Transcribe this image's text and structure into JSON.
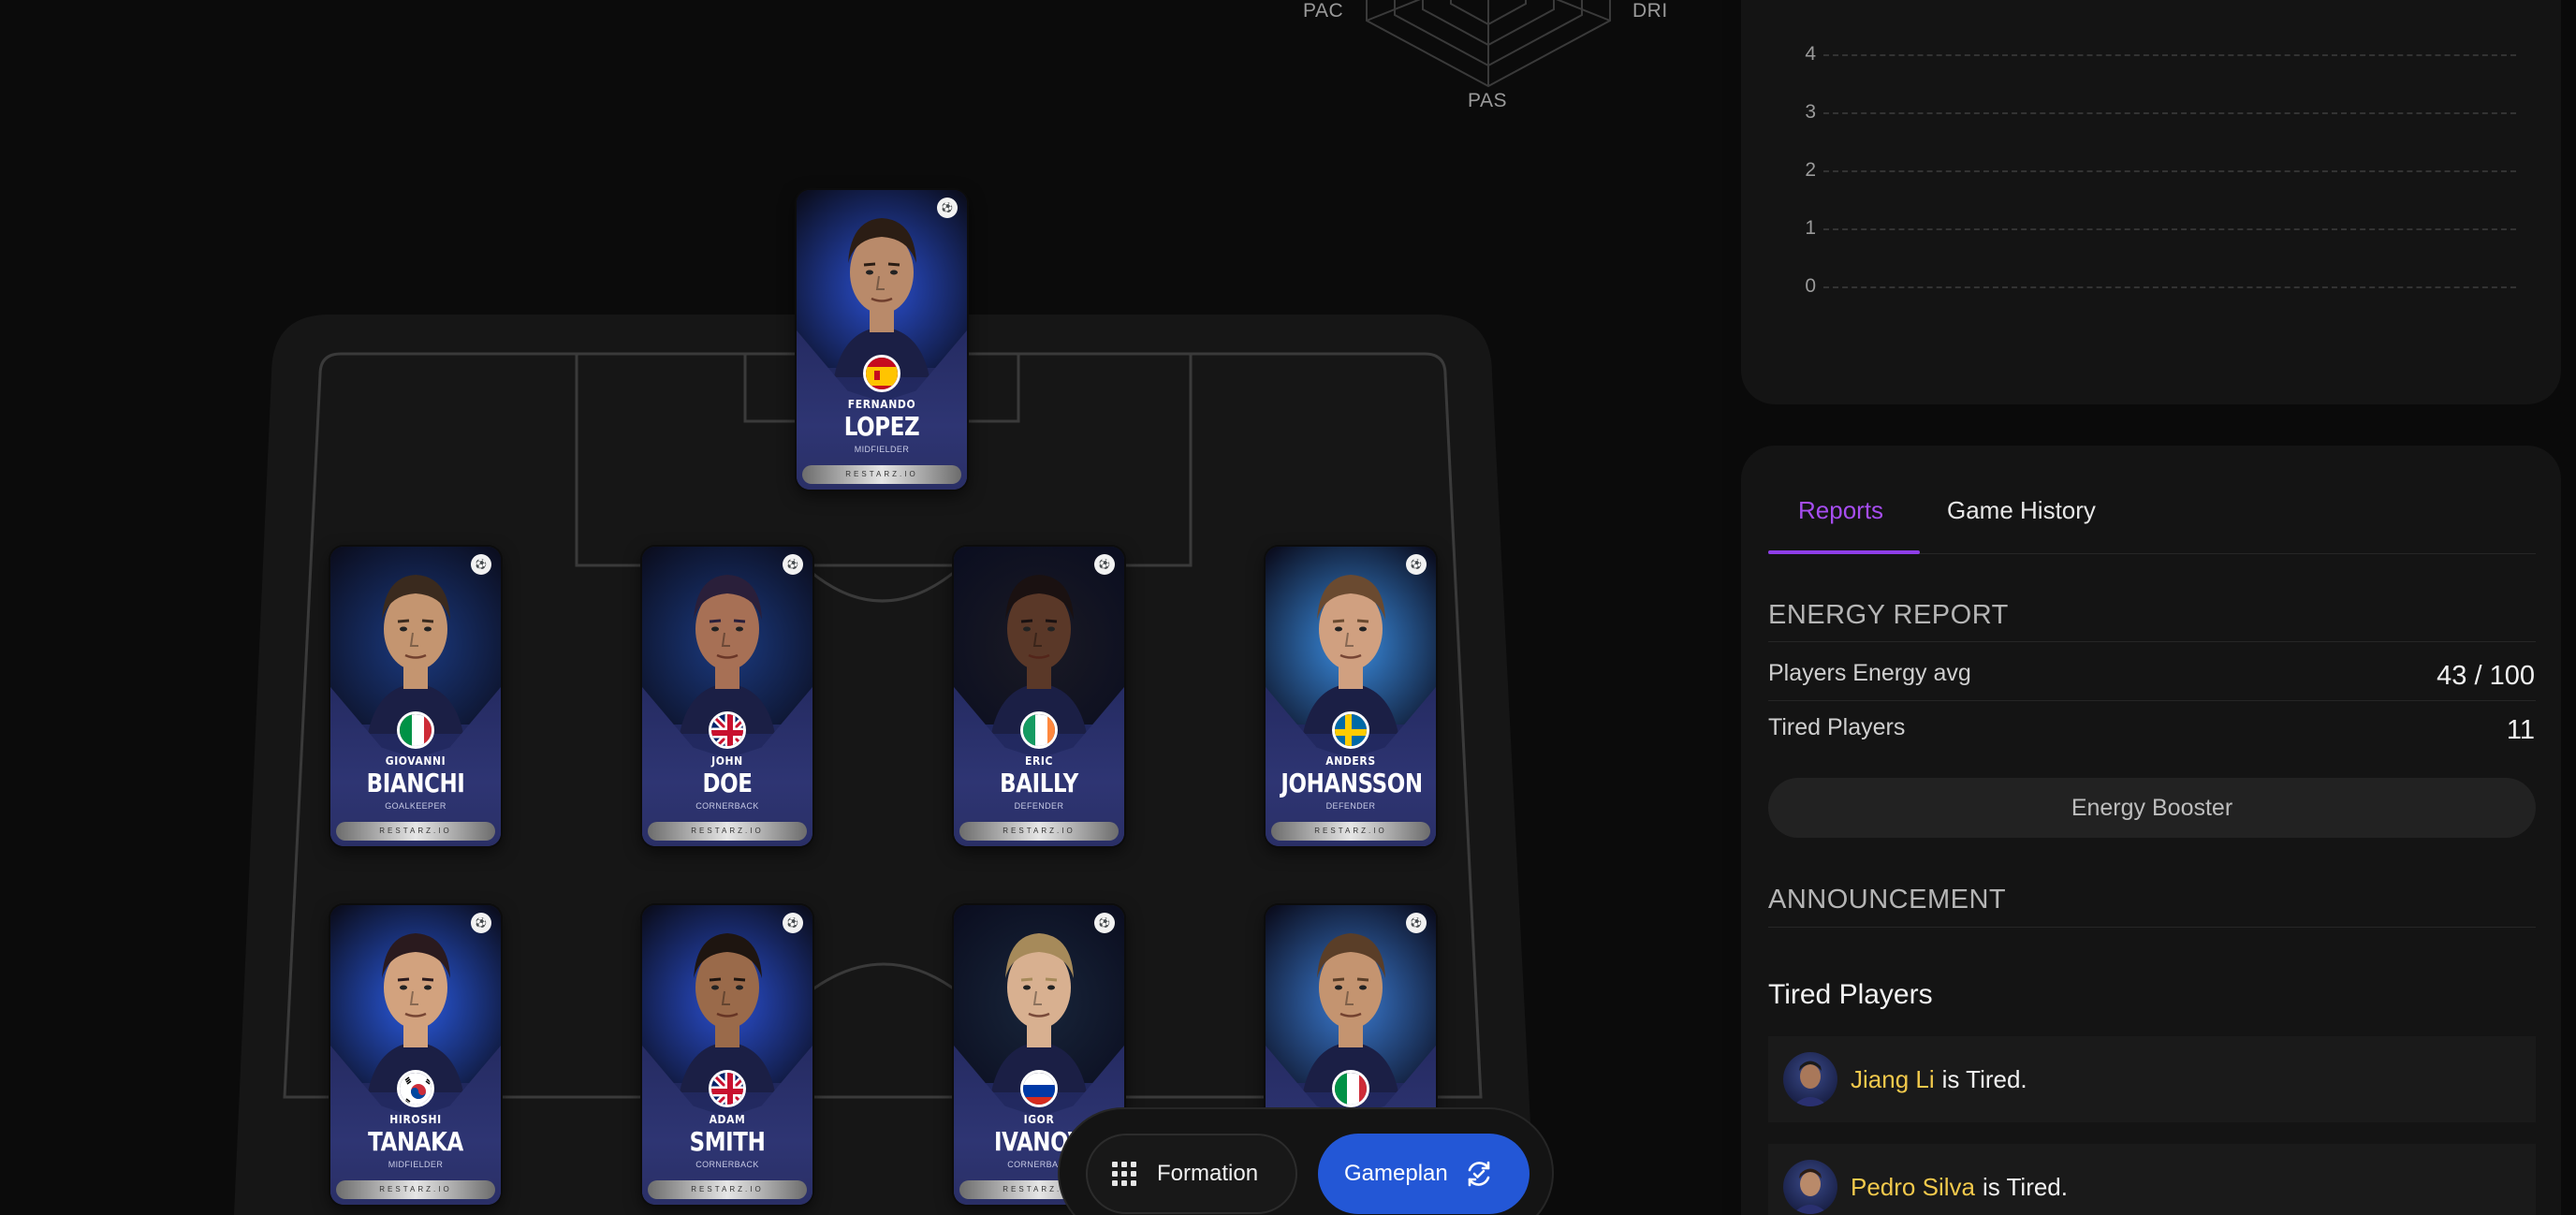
{
  "radar": {
    "labels": {
      "left": "PAC",
      "right": "DRI",
      "bottom": "PAS"
    }
  },
  "players": [
    {
      "first": "FERNANDO",
      "last": "LOPEZ",
      "position": "MIDFIELDER",
      "flag": "spain",
      "footer": "RESTARZ.IO"
    },
    {
      "first": "GIOVANNI",
      "last": "BIANCHI",
      "position": "GOALKEEPER",
      "flag": "italy",
      "footer": "RESTARZ.IO"
    },
    {
      "first": "JOHN",
      "last": "DOE",
      "position": "CORNERBACK",
      "flag": "uk",
      "footer": "RESTARZ.IO"
    },
    {
      "first": "ERIC",
      "last": "BAILLY",
      "position": "DEFENDER",
      "flag": "ireland",
      "footer": "RESTARZ.IO"
    },
    {
      "first": "ANDERS",
      "last": "JOHANSSON",
      "position": "DEFENDER",
      "flag": "sweden",
      "footer": "RESTARZ.IO"
    },
    {
      "first": "HIROSHI",
      "last": "TANAKA",
      "position": "MIDFIELDER",
      "flag": "korea",
      "footer": "RESTARZ.IO"
    },
    {
      "first": "ADAM",
      "last": "SMITH",
      "position": "CORNERBACK",
      "flag": "uk",
      "footer": "RESTARZ.IO"
    },
    {
      "first": "IGOR",
      "last": "IVANOV",
      "position": "CORNERBACK",
      "flag": "russia",
      "footer": "RESTARZ.IO"
    },
    {
      "first": "",
      "last": "",
      "position": "",
      "flag": "italy",
      "footer": ""
    }
  ],
  "toolbar": {
    "formation_label": "Formation",
    "gameplan_label": "Gameplan",
    "accent": "#2357d6"
  },
  "chart_data": {
    "type": "line",
    "y_ticks": [
      "4",
      "3",
      "2",
      "1",
      "0"
    ],
    "ylim": [
      0,
      4
    ],
    "grid": true,
    "series": []
  },
  "tabs": {
    "reports": "Reports",
    "history": "Game History",
    "active_color": "#a64df0"
  },
  "energy": {
    "title": "ENERGY REPORT",
    "avg_label": "Players Energy avg",
    "avg_value": "43 / 100",
    "tired_label": "Tired Players",
    "tired_value": "11",
    "booster_label": "Energy Booster"
  },
  "announcement": {
    "title": "ANNOUNCEMENT",
    "heading": "Tired Players",
    "items": [
      {
        "name": "Jiang Li",
        "text": "is Tired."
      },
      {
        "name": "Pedro Silva",
        "text": "is Tired."
      }
    ],
    "name_color": "#f2c94c"
  }
}
